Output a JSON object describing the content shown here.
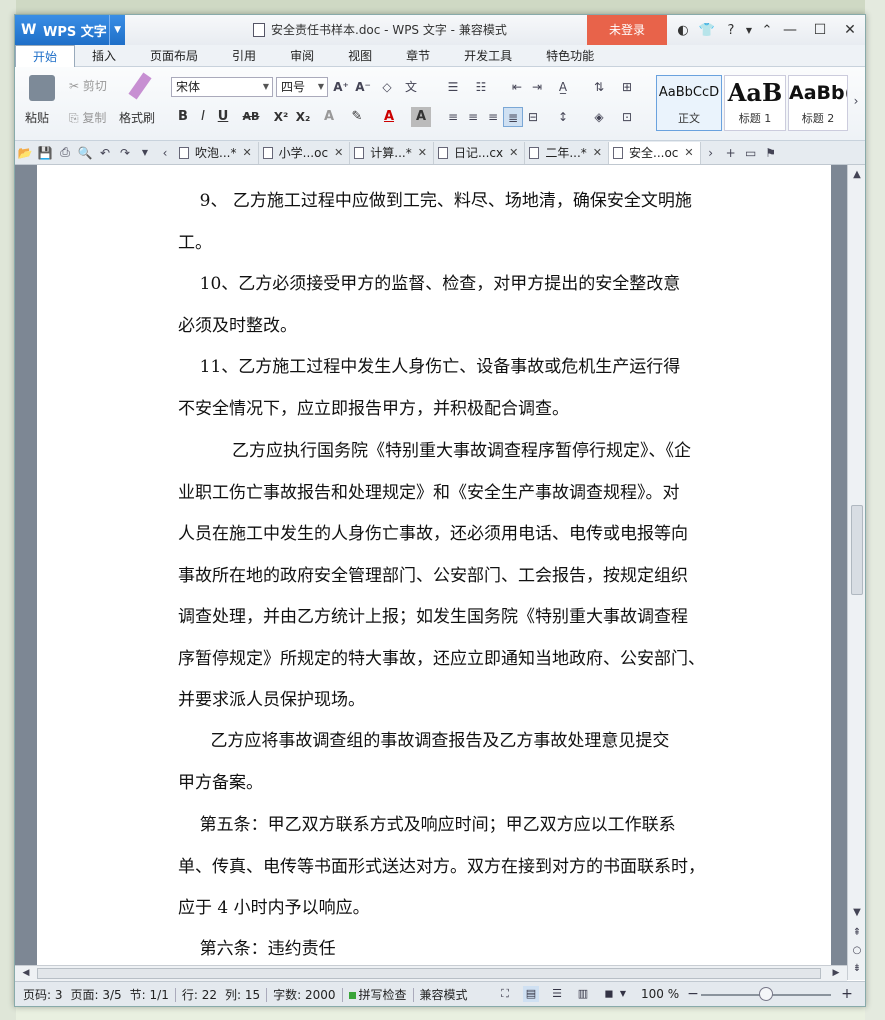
{
  "app": {
    "name": "WPS 文字",
    "window_title": "安全责任书样本.doc - WPS 文字 - 兼容模式",
    "login_label": "未登录",
    "help_label": "?"
  },
  "ribbon": {
    "tabs": [
      "开始",
      "插入",
      "页面布局",
      "引用",
      "审阅",
      "视图",
      "章节",
      "开发工具",
      "特色功能"
    ],
    "paste_label": "粘贴",
    "cut_label": "剪切",
    "copy_label": "复制",
    "format_painter_label": "格式刷",
    "font_name": "宋体",
    "font_size": "四号",
    "styles": [
      {
        "sample": "AaBbCcD",
        "name": "正文"
      },
      {
        "sample": "AaB",
        "name": "标题 1"
      },
      {
        "sample": "AaBb(",
        "name": "标题 2"
      }
    ]
  },
  "doc_tabs": [
    {
      "label": "吹泡...",
      "modified": "*"
    },
    {
      "label": "小学...oc",
      "modified": ""
    },
    {
      "label": "计算...",
      "modified": "*"
    },
    {
      "label": "日记...cx",
      "modified": ""
    },
    {
      "label": "二年...",
      "modified": "*"
    },
    {
      "label": "安全...oc",
      "modified": "",
      "active": true
    }
  ],
  "document": {
    "paragraphs": [
      "    9、 乙方施工过程中应做到工完、料尽、场地清，确保安全文明施\n工。",
      "    10、乙方必须接受甲方的监督、检查，对甲方提出的安全整改意\n必须及时整改。",
      "    11、乙方施工过程中发生人身伤亡、设备事故或危机生产运行得\n不安全情况下，应立即报告甲方，并积极配合调查。",
      "          乙方应执行国务院《特别重大事故调查程序暂停行规定》、《企\n业职工伤亡事故报告和处理规定》和《安全生产事故调查规程》。对\n人员在施工中发生的人身伤亡事故，还必须用电话、电传或电报等向\n事故所在地的政府安全管理部门、公安部门、工会报告，按规定组织\n调查处理，并由乙方统计上报；如发生国务院《特别重大事故调查程\n序暂停规定》所规定的特大事故，还应立即通知当地政府、公安部门、\n并要求派人员保护现场。",
      "      乙方应将事故调查组的事故调查报告及乙方事故处理意见提交\n甲方备案。",
      "    第五条：甲乙双方联系方式及响应时间；甲乙双方应以工作联系\n单、传真、电传等书面形式送达对方。双方在接到对方的书面联系时，\n应于 4 小时内予以响应。",
      "    第六条：违约责任"
    ]
  },
  "status": {
    "page_code": "页码: 3",
    "page_count": "页面: 3/5",
    "section": "节: 1/1",
    "row": "行: 22",
    "col": "列: 15",
    "word_count": "字数: 2000",
    "spell_check": "拼写检查",
    "compat_mode": "兼容模式",
    "zoom": "100 %",
    "zoom_fraction": 0.5
  },
  "colors": {
    "brand_blue": "#1f6fc8",
    "login_red": "#e8634a",
    "page_bg": "#7d8794"
  }
}
